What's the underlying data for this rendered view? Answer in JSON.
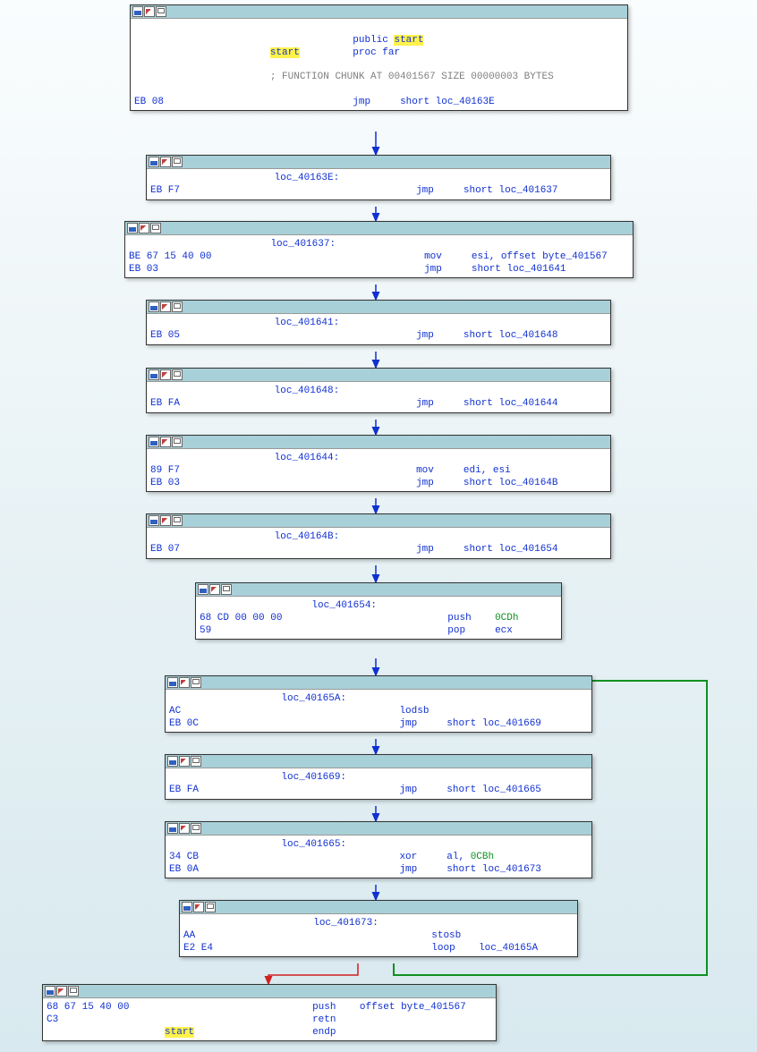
{
  "nodes": {
    "n0": {
      "public": "public ",
      "start_hl": "start",
      "proc": "proc far",
      "start_lbl": "start",
      "comment": "; FUNCTION CHUNK AT 00401567 SIZE 00000003 BYTES",
      "bytes0": "EB 08",
      "mnem0": "jmp",
      "op0": "short loc_40163E"
    },
    "n1": {
      "label": "loc_40163E:",
      "bytes0": "EB F7",
      "mnem0": "jmp",
      "op0": "short loc_401637"
    },
    "n2": {
      "label": "loc_401637:",
      "bytes0": "BE 67 15 40 00",
      "mnem0": "mov",
      "op0": "esi, offset byte_401567",
      "bytes1": "EB 03",
      "mnem1": "jmp",
      "op1": "short loc_401641"
    },
    "n3": {
      "label": "loc_401641:",
      "bytes0": "EB 05",
      "mnem0": "jmp",
      "op0": "short loc_401648"
    },
    "n4": {
      "label": "loc_401648:",
      "bytes0": "EB FA",
      "mnem0": "jmp",
      "op0": "short loc_401644"
    },
    "n5": {
      "label": "loc_401644:",
      "bytes0": "89 F7",
      "mnem0": "mov",
      "op0": "edi, esi",
      "bytes1": "EB 03",
      "mnem1": "jmp",
      "op1": "short loc_40164B"
    },
    "n6": {
      "label": "loc_40164B:",
      "bytes0": "EB 07",
      "mnem0": "jmp",
      "op0": "short loc_401654"
    },
    "n7": {
      "label": "loc_401654:",
      "bytes0": "68 CD 00 00 00",
      "mnem0": "push",
      "op0": "0CDh",
      "bytes1": "59",
      "mnem1": "pop",
      "op1": "ecx"
    },
    "n8": {
      "label": "loc_40165A:",
      "bytes0": "AC",
      "mnem0": "lodsb",
      "bytes1": "EB 0C",
      "mnem1": "jmp",
      "op1": "short loc_401669"
    },
    "n9": {
      "label": "loc_401669:",
      "bytes0": "EB FA",
      "mnem0": "jmp",
      "op0": "short loc_401665"
    },
    "n10": {
      "label": "loc_401665:",
      "bytes0": "34 CB",
      "mnem0": "xor",
      "op0_a": "al, ",
      "op0_b": "0CBh",
      "bytes1": "EB 0A",
      "mnem1": "jmp",
      "op1": "short loc_401673"
    },
    "n11": {
      "label": "loc_401673:",
      "bytes0": "AA",
      "mnem0": "stosb",
      "bytes1": "E2 E4",
      "mnem1": "loop",
      "op1": "loc_40165A"
    },
    "n12": {
      "bytes0": "68 67 15 40 00",
      "mnem0": "push",
      "op0": "offset byte_401567",
      "bytes1": "C3",
      "mnem1": "retn",
      "start_lbl": "start",
      "mnem2": "endp"
    }
  }
}
